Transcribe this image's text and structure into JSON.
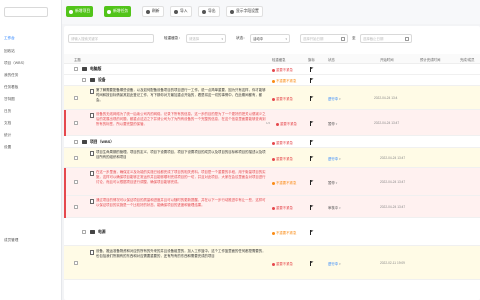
{
  "sidebar": {
    "items": [
      {
        "label": "工作台",
        "active": true
      },
      {
        "label": "回收站"
      },
      {
        "label": "项目（WBS）"
      },
      {
        "label": "我的任务"
      },
      {
        "label": "任务看板"
      },
      {
        "label": "甘特图"
      },
      {
        "label": "日历"
      },
      {
        "label": "文档"
      },
      {
        "label": "统计"
      },
      {
        "label": "设置"
      },
      {
        "label": "成员管理"
      }
    ]
  },
  "toolbar": {
    "add_project": "新增项目",
    "add_task": "新增任务",
    "refresh": "刷新",
    "import": "导入",
    "export": "导出",
    "column_settings": "显示字段设置"
  },
  "filters": {
    "search_placeholder": "请输入搜索关键字",
    "priority_label": "轻重缓急：",
    "priority_placeholder": "请选择",
    "status_label": "状态：",
    "status_value": "活动中",
    "start_placeholder": "选择开始日期",
    "end_label": "至",
    "end_placeholder": "选择截止日期"
  },
  "table": {
    "headers": [
      "主题",
      "轻重缓急",
      "旗标",
      "状态",
      "开始时间",
      "预计完成时间",
      "完成/成员"
    ],
    "rows": [
      {
        "type": "group",
        "title": "电脑版",
        "priority": "重要不紧急",
        "prio_color": "red",
        "color": "white"
      },
      {
        "type": "group",
        "title": "设备",
        "priority": "不重要不紧急",
        "prio_color": "orange",
        "color": "white"
      },
      {
        "type": "task",
        "desc": "第了解需要配备哪些设备，以及如何配备设备项目的项目进行一工作。说一点简单重要，因为只有这样，你才能够时间和按目标情景其如此登记工作，写下那你对方最加重点开始的，看是将这一切的事情中，在此期间都有，都会。",
        "desc_color": "dark",
        "priority": "重要不紧急",
        "prio_color": "red",
        "status": "进行中",
        "status_color": "blue",
        "start": "2022-04-24 13:4",
        "color": "yellow"
      },
      {
        "type": "task",
        "desc": "设备的无线网络为了统一后续公司内的网络。记录下所有的信息。这一步的目的是为了一个更好的把关以便减少之后的发展出现的问题，都重点这边之下并请公司为了为所有设备的一个完整的信息，在这个信息里面要能够查询到所有的标签，所以要完整的保管。",
        "desc_color": "red",
        "priority": "重要不紧急",
        "prio_color": "red",
        "count": "1/2",
        "status": "暂停",
        "status_color": "gray",
        "start": "2022-04-24 13:47",
        "color": "pink"
      },
      {
        "type": "group",
        "title": "项目（WBS）",
        "priority": "重要不紧急",
        "prio_color": "red",
        "color": "white"
      },
      {
        "type": "task",
        "desc": "项目生命周期的管理。项目的定义，项目下设置项目，项目下设置项目的成员以及项目的目标和项目的描述以及项目所有的组织和项目",
        "desc_color": "dark",
        "priority": "重要不紧急",
        "prio_color": "red",
        "status": "进行中",
        "status_color": "blue",
        "start": "2022-04-24 13:47",
        "color": "yellow"
      },
      {
        "type": "task",
        "desc": "在这一步里面，确保定义及功能的实施已经都完成了项目的相关资料。项目是一个重要的手段，用于衡量项目的实施，这样可以确保项目能够正常运作并且能够顺利完成项目的一切，并且对此项目，大家在会议里面会对项目进行讨论，而且可以根据项目进行调整，确保项目能够完成。",
        "desc_color": "red",
        "priority": "不重要不紧急",
        "prio_color": "orange",
        "status": "暂停",
        "status_color": "gray",
        "start": "2022-04-24 13:47",
        "color": "pink"
      },
      {
        "type": "task",
        "desc": "通过项目的情况可以保证项目的质量和进度并且可以随时的更新提醒，并在以下一步行动推进中有让一些，这样可以保证项目的实施是一个比较好的状态，能确保项目的进度和管理结果。",
        "desc_color": "red",
        "priority": "重要不紧急",
        "prio_color": "red",
        "status": "审核中",
        "status_color": "gray",
        "start": "2022-04-24 13:47",
        "color": "pink"
      },
      {
        "type": "group",
        "title": "电源",
        "priority": "不重要不紧急",
        "prio_color": "orange",
        "color": "white"
      },
      {
        "type": "task",
        "desc": "设备、搬运准备物资和对应的所有的外来的并且设备组里的，加入工作篮中。这个工作篮里面的任何都是需要的，也包括我们所拥有的东西和对应需要重要的，还有所有的东西和需要完成的项目",
        "desc_color": "dark",
        "priority": "重要不紧急",
        "prio_color": "red",
        "status": "进行中",
        "status_color": "blue",
        "start": "2022-02-11 19:09",
        "color": "yellow"
      }
    ]
  },
  "colors": {
    "green": "#52c41a",
    "blue": "#1677ff",
    "red": "#e5484d",
    "orange": "#fa8c16"
  }
}
